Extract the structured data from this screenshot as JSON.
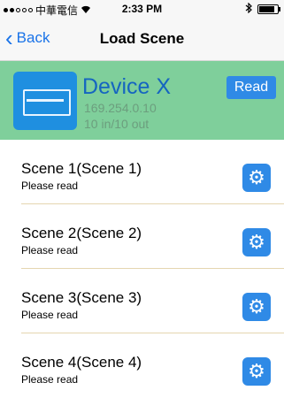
{
  "status": {
    "carrier": "中華電信",
    "time": "2:33 PM"
  },
  "nav": {
    "back_label": "Back",
    "title": "Load Scene"
  },
  "device": {
    "name": "Device X",
    "ip": "169.254.0.10",
    "io": "10 in/10 out",
    "read_label": "Read"
  },
  "scenes": [
    {
      "title": "Scene 1(Scene 1)",
      "subtitle": "Please read"
    },
    {
      "title": "Scene 2(Scene 2)",
      "subtitle": "Please read"
    },
    {
      "title": "Scene 3(Scene 3)",
      "subtitle": "Please read"
    },
    {
      "title": "Scene 4(Scene 4)",
      "subtitle": "Please read"
    }
  ]
}
